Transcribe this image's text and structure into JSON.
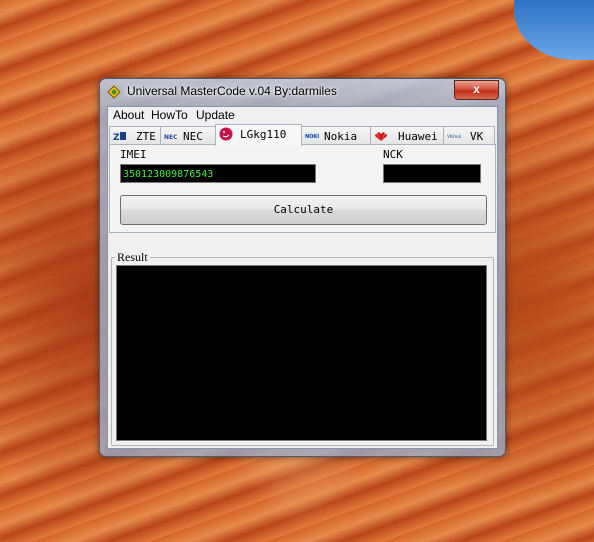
{
  "window": {
    "title": "Universal MasterCode v.04 By:darmiles",
    "close_label": "x"
  },
  "menu": [
    "About",
    "HowTo",
    "Update"
  ],
  "tabs": [
    {
      "label": "ZTE",
      "icon": "zte-logo-icon",
      "active": false
    },
    {
      "label": "NEC",
      "icon": "nec-logo-icon",
      "active": false
    },
    {
      "label": "LGkg110",
      "icon": "lg-logo-icon",
      "active": true
    },
    {
      "label": "Nokia",
      "icon": "nokia-logo-icon",
      "active": false
    },
    {
      "label": "Huawei",
      "icon": "huawei-logo-icon",
      "active": false
    },
    {
      "label": "VK",
      "icon": "vk-logo-icon",
      "active": false
    }
  ],
  "form": {
    "imei_label": "IMEI",
    "imei_value": "350123009876543",
    "nck_label": "NCK",
    "nck_value": "",
    "calculate_label": "Calculate"
  },
  "result": {
    "label": "Result",
    "value": ""
  },
  "colors": {
    "field_bg": "#000000",
    "field_text": "#3df03d",
    "close_button": "#c7351f"
  }
}
